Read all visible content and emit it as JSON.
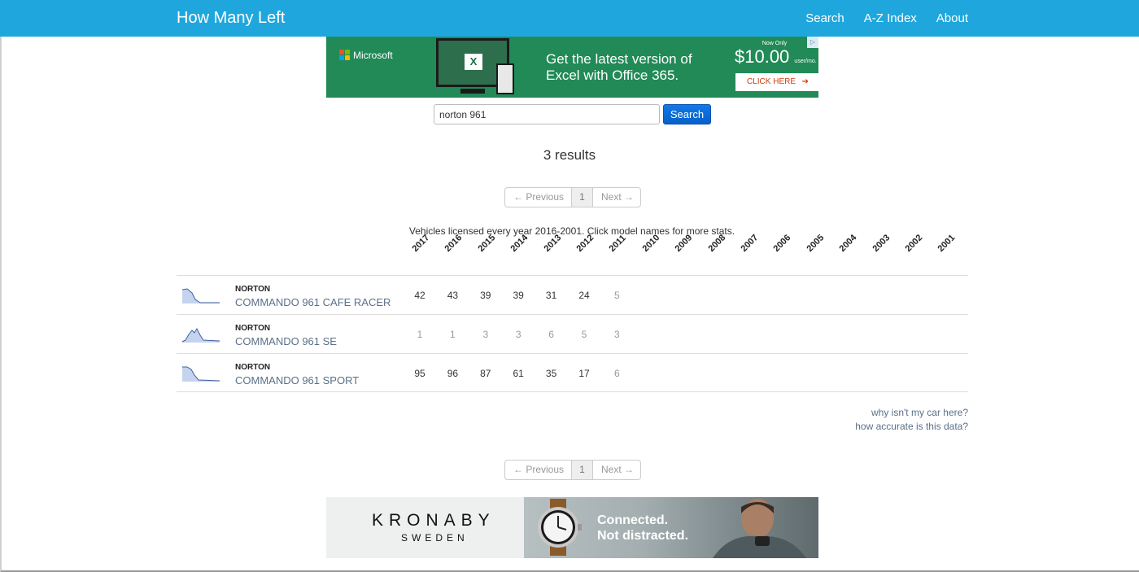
{
  "nav": {
    "brand": "How Many Left",
    "links": [
      "Search",
      "A-Z Index",
      "About"
    ]
  },
  "ad_top": {
    "brand": "Microsoft",
    "headline_1": "Get the latest version of",
    "headline_2": "Excel with Office 365.",
    "now_only": "Now Only",
    "price": "$10.00",
    "price_unit": "user/mo.",
    "cta": "CLICK HERE"
  },
  "search": {
    "value": "norton 961",
    "button": "Search"
  },
  "results_text": "3 results",
  "pager": {
    "prev": "← Previous",
    "page": "1",
    "next": "Next →"
  },
  "note": "Vehicles licensed every year 2016-2001. Click model names for more stats.",
  "years": [
    "2017",
    "2016",
    "2015",
    "2014",
    "2013",
    "2012",
    "2011",
    "2010",
    "2009",
    "2008",
    "2007",
    "2006",
    "2005",
    "2004",
    "2003",
    "2002",
    "2001"
  ],
  "vehicles": [
    {
      "make": "NORTON",
      "model": "COMMANDO 961 CAFE RACER",
      "counts": [
        "42",
        "43",
        "39",
        "39",
        "31",
        "24",
        "5"
      ],
      "style": "dark"
    },
    {
      "make": "NORTON",
      "model": "COMMANDO 961 SE",
      "counts": [
        "1",
        "1",
        "3",
        "3",
        "6",
        "5",
        "3"
      ],
      "style": "light"
    },
    {
      "make": "NORTON",
      "model": "COMMANDO 961 SPORT",
      "counts": [
        "95",
        "96",
        "87",
        "61",
        "35",
        "17",
        "6"
      ],
      "style": "dark"
    }
  ],
  "help_links": [
    "why isn't my car here?",
    "how accurate is this data?"
  ],
  "ad_bottom": {
    "brand": "KRONABY",
    "country": "SWEDEN",
    "tagline_1": "Connected.",
    "tagline_2": "Not distracted."
  },
  "colors": {
    "navbar": "#1fa7dd",
    "ad_green": "#218a57",
    "search_button": "#0560c9",
    "model_link": "#5b7088"
  }
}
